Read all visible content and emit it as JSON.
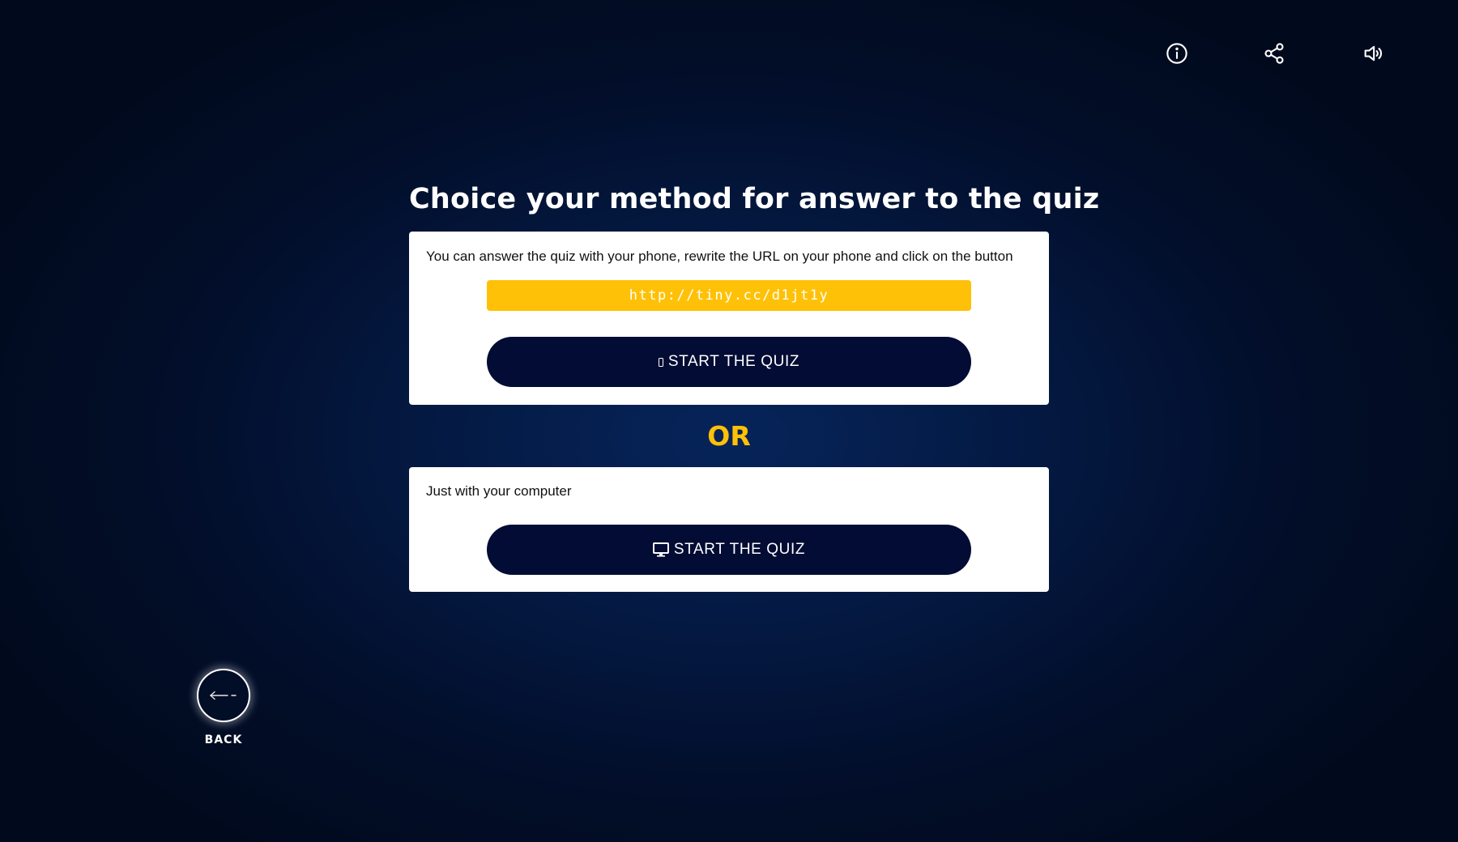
{
  "header": {
    "icons": [
      "info-icon",
      "share-icon",
      "sound-icon"
    ]
  },
  "main": {
    "title": "Choice your method for answer to the quiz",
    "phone_card": {
      "text": "You can answer the quiz with your phone, rewrite the URL on your phone and click on the button",
      "url": "http://tiny.cc/d1jt1y",
      "button_label": "START THE QUIZ",
      "button_icon": "mobile-phone-icon"
    },
    "separator": "OR",
    "computer_card": {
      "text": "Just with your computer",
      "button_label": "START THE QUIZ",
      "button_icon": "desktop-computer-icon"
    }
  },
  "back": {
    "label": "BACK",
    "icon": "arrow-left-icon"
  },
  "colors": {
    "accent_yellow": "#ffc107",
    "button_navy": "#020c34",
    "background_navy": "#041a44"
  }
}
